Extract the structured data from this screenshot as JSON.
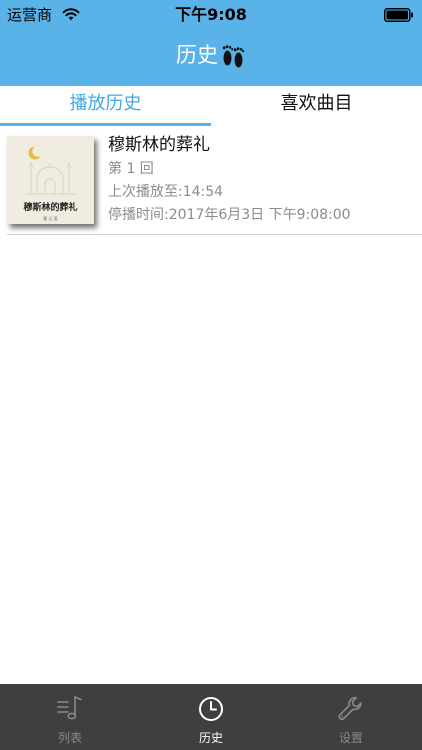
{
  "status_bar": {
    "carrier": "运营商",
    "time": "下午9:08"
  },
  "nav": {
    "title": "历史",
    "title_icon": "footprints-icon",
    "background_color": "#5ab3e8"
  },
  "tabs": [
    {
      "label": "播放历史",
      "active": true
    },
    {
      "label": "喜欢曲目",
      "active": false
    }
  ],
  "history_items": [
    {
      "title": "穆斯林的葬礼",
      "cover_title": "穆斯林的葬礼",
      "cover_author": "霍 达 著",
      "episode": "第 1 回",
      "last_position": "上次播放至:14:54",
      "stopped_at": "停播时间:2017年6月3日 下午9:08:00"
    }
  ],
  "tabbar": {
    "items": [
      {
        "label": "列表",
        "icon": "playlist-icon",
        "active": false
      },
      {
        "label": "历史",
        "icon": "clock-icon",
        "active": true
      },
      {
        "label": "设置",
        "icon": "wrench-icon",
        "active": false
      }
    ]
  },
  "colors": {
    "accent": "#5ab3e8",
    "tabbar_background": "#3f3f3f",
    "active_tab_text": "#44a8e0"
  }
}
